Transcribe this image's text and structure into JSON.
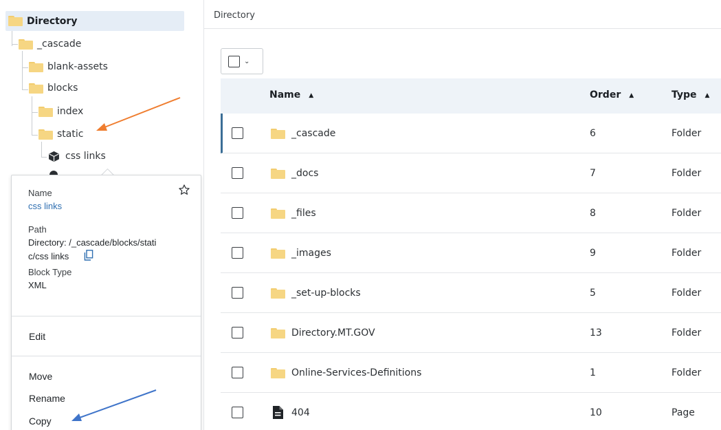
{
  "tree": {
    "root_label": "Directory",
    "items": [
      {
        "label": "_cascade",
        "type": "folder"
      },
      {
        "label": "blank-assets",
        "type": "folder"
      },
      {
        "label": "blocks",
        "type": "folder"
      },
      {
        "label": "index",
        "type": "folder"
      },
      {
        "label": "static",
        "type": "folder"
      },
      {
        "label": "css links",
        "type": "block",
        "icon": "cube-icon"
      }
    ]
  },
  "popover": {
    "name_label": "Name",
    "name_value": "css links",
    "path_label": "Path",
    "path_value_line1": "Directory: /_cascade/blocks/stati",
    "path_value_line2": "c/css links",
    "block_type_label": "Block Type",
    "block_type_value": "XML",
    "actions": {
      "edit": "Edit",
      "move": "Move",
      "rename": "Rename",
      "copy": "Copy"
    }
  },
  "main": {
    "breadcrumb": "Directory",
    "columns": {
      "name": "Name",
      "order": "Order",
      "type": "Type"
    },
    "rows": [
      {
        "name": "_cascade",
        "order": "6",
        "type": "Folder",
        "icon": "folder-icon"
      },
      {
        "name": "_docs",
        "order": "7",
        "type": "Folder",
        "icon": "folder-icon"
      },
      {
        "name": "_files",
        "order": "8",
        "type": "Folder",
        "icon": "folder-icon"
      },
      {
        "name": "_images",
        "order": "9",
        "type": "Folder",
        "icon": "folder-icon"
      },
      {
        "name": "_set-up-blocks",
        "order": "5",
        "type": "Folder",
        "icon": "folder-icon"
      },
      {
        "name": "Directory.MT.GOV",
        "order": "13",
        "type": "Folder",
        "icon": "folder-icon"
      },
      {
        "name": "Online-Services-Definitions",
        "order": "1",
        "type": "Folder",
        "icon": "folder-icon"
      },
      {
        "name": "404",
        "order": "10",
        "type": "Page",
        "icon": "page-icon"
      }
    ]
  },
  "colors": {
    "folder": "#f6d683",
    "link": "#2f6fb1",
    "header_bg": "#eef3f8",
    "selected_tree_bg": "#e5edf6",
    "annotation_orange": "#ef7d2f",
    "annotation_blue": "#3f74c9"
  }
}
